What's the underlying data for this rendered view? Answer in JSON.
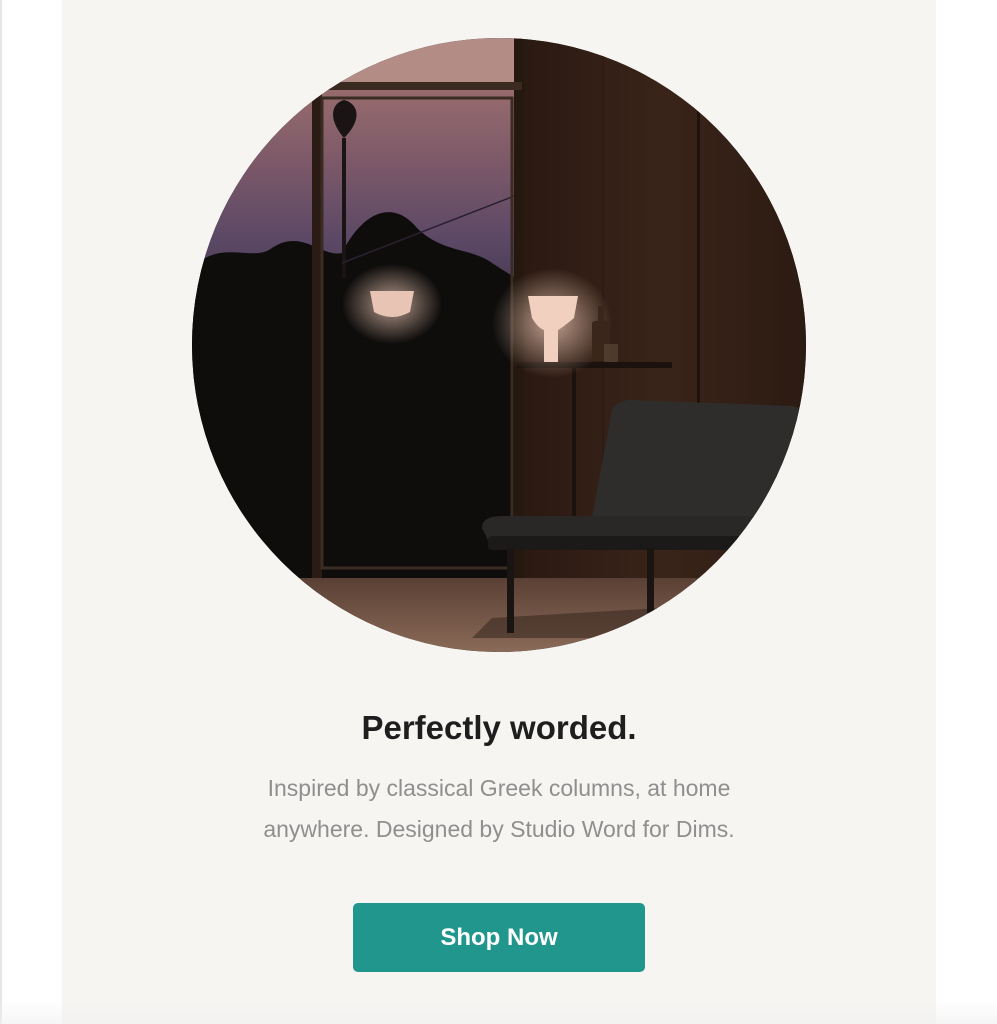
{
  "hero": {
    "image": "dark living room at dusk with glowing table lamps, window view of palm trees, side table and lounge chair"
  },
  "content": {
    "headline": "Perfectly worded.",
    "description_line1": "Inspired by classical Greek columns, at home",
    "description_line2": "anywhere. Designed by Studio Word for Dims."
  },
  "cta": {
    "label": "Shop Now"
  },
  "colors": {
    "card_background": "#f6f5f2",
    "button": "#20968d",
    "headline": "#1e1e1e",
    "body_text": "#8f8f8f"
  }
}
